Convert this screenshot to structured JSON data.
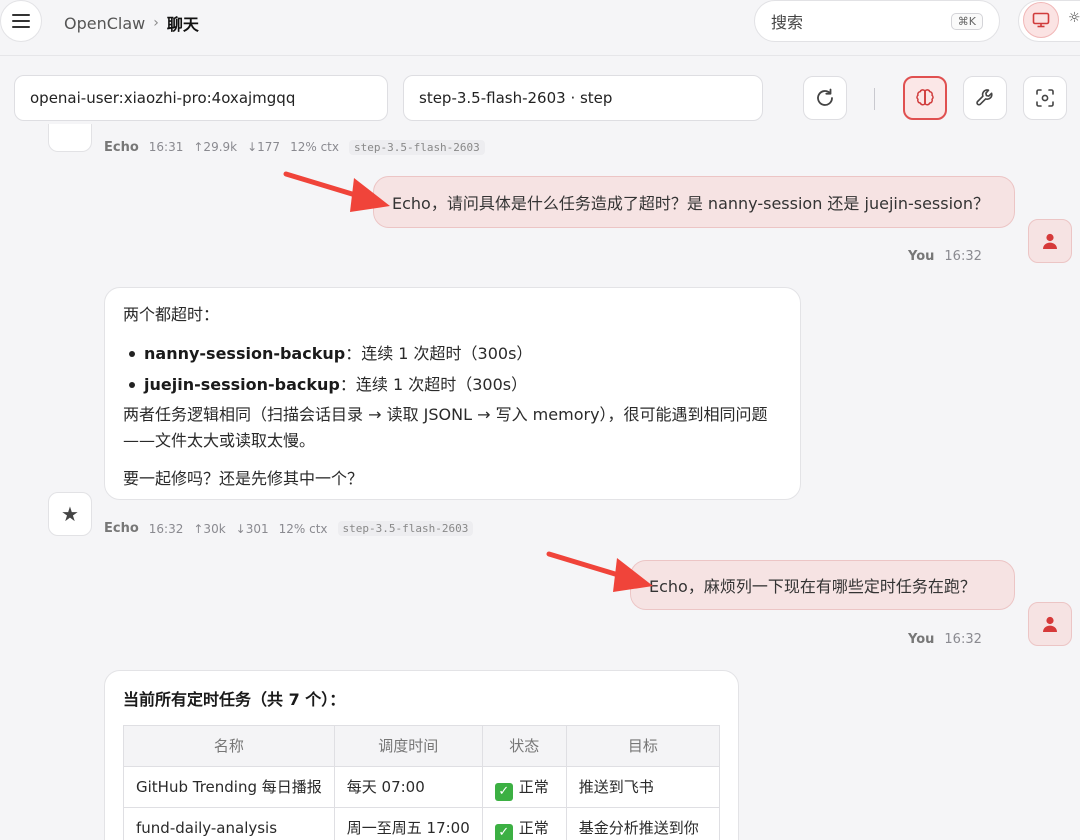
{
  "header": {
    "breadcrumb_root": "OpenClaw",
    "breadcrumb_separator": "›",
    "breadcrumb_current": "聊天",
    "search_label": "搜索",
    "search_shortcut": "⌘K"
  },
  "session_bar": {
    "session_key": "openai-user:xiaozhi-pro:4oxajmgqq",
    "model": "step-3.5-flash-2603 · step"
  },
  "chat": {
    "prev_meta": {
      "sender": "Echo",
      "time": "16:31",
      "tokens_in": "↑29.9k",
      "tokens_out": "↓177",
      "ctx": "12% ctx",
      "model": "step-3.5-flash-2603"
    },
    "user_msg_1": {
      "text": "Echo，请问具体是什么任务造成了超时？是 nanny-session 还是 juejin-session？",
      "sender": "You",
      "time": "16:32"
    },
    "bot_msg_1": {
      "intro": "两个都超时：",
      "items": [
        {
          "name": "nanny-session-backup",
          "detail": "：连续 1 次超时（300s）"
        },
        {
          "name": "juejin-session-backup",
          "detail": "：连续 1 次超时（300s）"
        }
      ],
      "para": "两者任务逻辑相同（扫描会话目录 → 读取 JSONL → 写入 memory），很可能遇到相同问题——文件太大或读取太慢。",
      "question": "要一起修吗？还是先修其中一个？"
    },
    "bot_meta_1": {
      "sender": "Echo",
      "time": "16:32",
      "tokens_in": "↑30k",
      "tokens_out": "↓301",
      "ctx": "12% ctx",
      "model": "step-3.5-flash-2603"
    },
    "user_msg_2": {
      "text": "Echo，麻烦列一下现在有哪些定时任务在跑？",
      "sender": "You",
      "time": "16:32"
    },
    "bot_msg_2": {
      "title": "当前所有定时任务（共 7 个）：",
      "columns": [
        "名称",
        "调度时间",
        "状态",
        "目标"
      ],
      "rows": [
        {
          "name": "GitHub Trending 每日播报",
          "schedule": "每天 07:00",
          "status": "正常",
          "target": "推送到飞书"
        },
        {
          "name": "fund-daily-analysis",
          "schedule": "周一至周五 17:00",
          "status": "正常",
          "target": "基金分析推送到你"
        }
      ]
    }
  },
  "icons": {
    "menu": "hamburger-icon",
    "theme": "monitor-icon",
    "sun": "sun-icon",
    "refresh": "refresh-icon",
    "brain": "brain-icon",
    "wrench": "wrench-icon",
    "focus": "focus-icon",
    "user_avatar": "user-icon",
    "bot_avatar": "star-icon"
  },
  "colors": {
    "accent": "#e05050",
    "user_bubble": "#f6e3e3",
    "annotation_arrow": "#f0443a",
    "status_ok": "#3cb043"
  }
}
